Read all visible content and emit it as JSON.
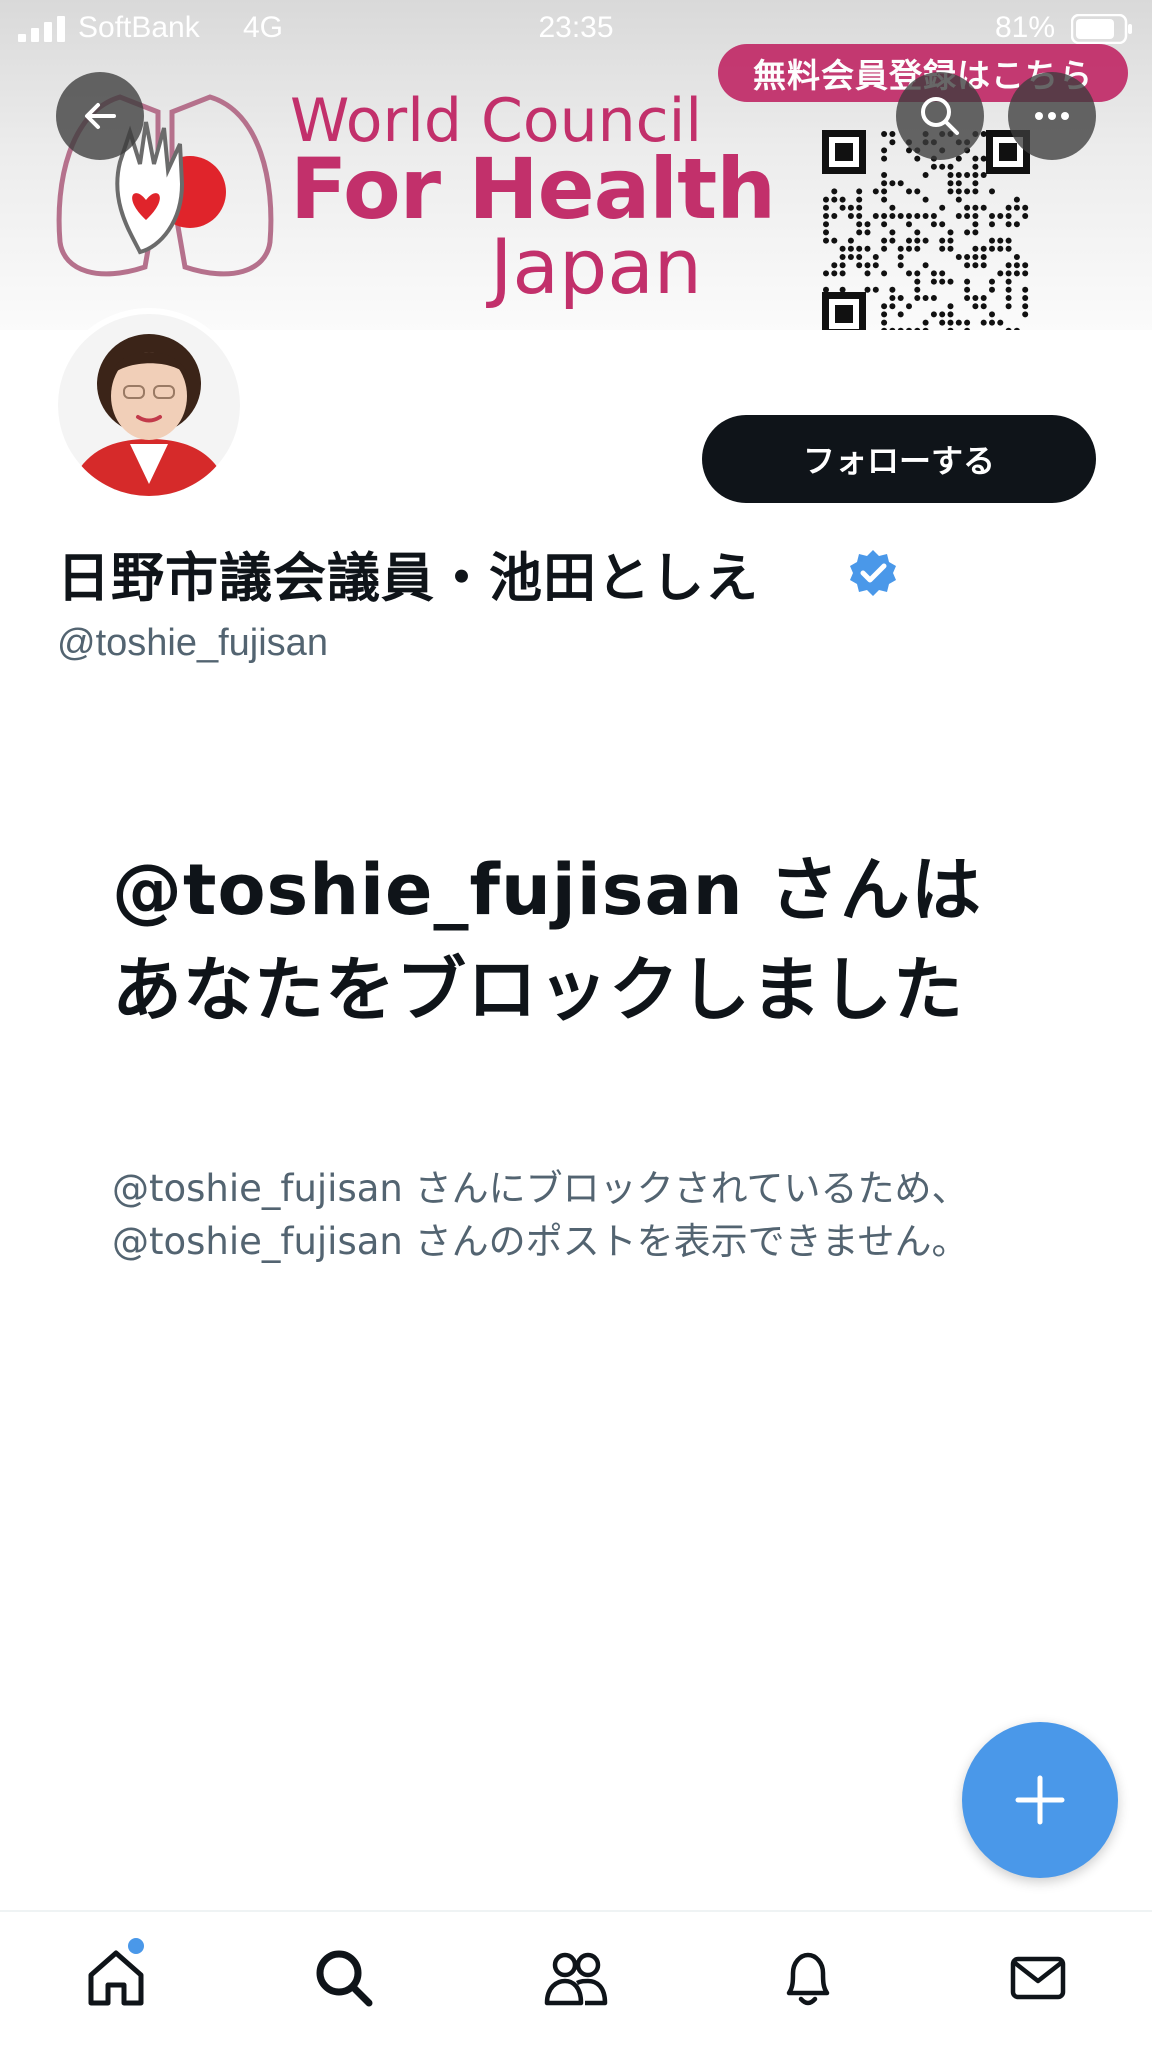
{
  "status_bar": {
    "carrier": "SoftBank",
    "network": "4G",
    "time": "23:35",
    "battery_percent": "81%"
  },
  "banner": {
    "org_line1": "World Council",
    "org_line2": "For Health",
    "org_line3": "Japan",
    "promo_text": "無料会員登録はこちら",
    "accent_color": "#c2306b"
  },
  "profile": {
    "follow_label": "フォローする",
    "display_name": "日野市議会議員・池田としえ",
    "handle": "@toshie_fujisan",
    "verified": true
  },
  "blocked": {
    "title": "@toshie_fujisan さんはあなたをブロックしました",
    "description": "@toshie_fujisan さんにブロックされているため、@toshie_fujisan さんのポストを表示できません。"
  },
  "compose": {
    "icon": "plus-icon",
    "color": "#4a98e9"
  },
  "tab_bar": {
    "items": [
      {
        "icon": "home-icon",
        "has_dot": true
      },
      {
        "icon": "search-icon"
      },
      {
        "icon": "communities-icon"
      },
      {
        "icon": "bell-icon"
      },
      {
        "icon": "mail-icon"
      }
    ]
  }
}
